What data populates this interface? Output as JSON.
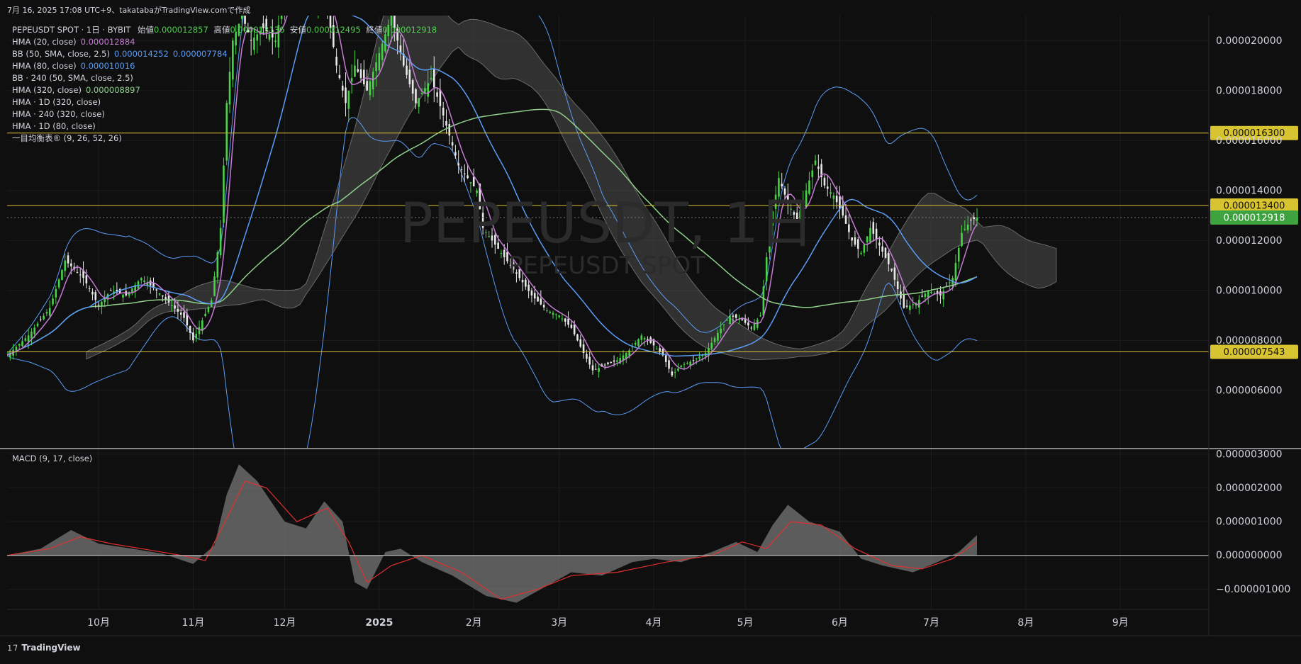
{
  "header": {
    "text": "7月 16, 2025 17:08 UTC+9、takatabaがTradingView.comで作成"
  },
  "legend": {
    "main_title": "PEPEUSDT SPOT · 1日 · BYBIT",
    "ohlc": [
      {
        "label": "始値",
        "value": "0.000012857"
      },
      {
        "label": "高値",
        "value": "0.000013136"
      },
      {
        "label": "安値",
        "value": "0.000012495"
      },
      {
        "label": "終値",
        "value": "0.000012918"
      }
    ],
    "indicators": [
      {
        "label": "HMA (20, close)",
        "values": [
          "0.000012884"
        ],
        "colors": [
          "#c77bd6"
        ]
      },
      {
        "label": "BB (50, SMA, close, 2.5)",
        "values": [
          "0.000014252",
          "0.000007784"
        ],
        "colors": [
          "#5b9cf6",
          "#5b9cf6"
        ]
      },
      {
        "label": "HMA (80, close)",
        "values": [
          "0.000010016"
        ],
        "colors": [
          "#5b9cf6"
        ]
      },
      {
        "label": "BB · 240 (50, SMA, close, 2.5)",
        "values": [],
        "colors": []
      },
      {
        "label": "HMA (320, close)",
        "values": [
          "0.000008897"
        ],
        "colors": [
          "#8fd18a"
        ]
      },
      {
        "label": "HMA · 1D (320, close)",
        "values": [],
        "colors": []
      },
      {
        "label": "HMA · 240 (320, close)",
        "values": [],
        "colors": []
      },
      {
        "label": "HMA · 1D (80, close)",
        "values": [],
        "colors": []
      },
      {
        "label": "一目均衡表® (9, 26, 52, 26)",
        "values": [],
        "colors": []
      }
    ]
  },
  "watermark": {
    "symbol": "PEPEUSDT, 1日",
    "sub": "PEPEUSDT SPOT"
  },
  "macd_label": "MACD (9, 17, close)",
  "footer": {
    "brand": "TradingView"
  },
  "colors": {
    "background": "#0f0f0f",
    "grid": "#1c1c1c",
    "up": "#4ad14a",
    "down": "#e8e8e8",
    "bb": "#5b9cf6",
    "hma20": "#c77bd6",
    "hma80": "#5b9cf6",
    "hma320": "#8fd18a",
    "hline": "#d8c330",
    "last_price": "#3ea33e",
    "cloud": "#5a5a5a",
    "macd_hist": "#777777",
    "macd_signal": "#e03030"
  },
  "chart_data": [
    {
      "type": "candlestick",
      "interval": "1日",
      "x_ticks": [
        "10月",
        "11月",
        "12月",
        "2025",
        "2月",
        "3月",
        "4月",
        "5月",
        "6月",
        "7月",
        "8月",
        "9月"
      ],
      "y_ticks": [
        "0.000020000",
        "0.000018000",
        "0.000016000",
        "0.000014000",
        "0.000012000",
        "0.000010000",
        "0.000008000",
        "0.000006000"
      ],
      "ylim": [
        3.7e-06,
        2.1e-05
      ],
      "horizontal_lines": [
        {
          "value": 1.63e-05,
          "label": "0.000016300"
        },
        {
          "value": 1.34e-05,
          "label": "0.000013400"
        },
        {
          "value": 7.543e-06,
          "label": "0.000007543"
        }
      ],
      "last_price": {
        "value": 1.2918e-05,
        "label": "0.000012918"
      },
      "close_path": [
        [
          "2024-09-01",
          7.4e-06
        ],
        [
          "2024-09-08",
          8.2e-06
        ],
        [
          "2024-09-15",
          9.3e-06
        ],
        [
          "2024-09-20",
          1.12e-05
        ],
        [
          "2024-09-26",
          1.05e-05
        ],
        [
          "2024-10-01",
          9.4e-06
        ],
        [
          "2024-10-05",
          1e-05
        ],
        [
          "2024-10-10",
          9.8e-06
        ],
        [
          "2024-10-15",
          1.05e-05
        ],
        [
          "2024-10-20",
          1e-05
        ],
        [
          "2024-10-25",
          9.4e-06
        ],
        [
          "2024-10-29",
          8.9e-06
        ],
        [
          "2024-11-01",
          8e-06
        ],
        [
          "2024-11-04",
          8.8e-06
        ],
        [
          "2024-11-07",
          9.6e-06
        ],
        [
          "2024-11-10",
          1.25e-05
        ],
        [
          "2024-11-12",
          1.75e-05
        ],
        [
          "2024-11-14",
          2e-05
        ],
        [
          "2024-11-17",
          2.1e-05
        ],
        [
          "2024-11-20",
          2e-05
        ],
        [
          "2024-11-24",
          2.05e-05
        ],
        [
          "2024-11-28",
          2e-05
        ],
        [
          "2024-12-02",
          2.25e-05
        ],
        [
          "2024-12-06",
          2.4e-05
        ],
        [
          "2024-12-10",
          2.15e-05
        ],
        [
          "2024-12-14",
          2.2e-05
        ],
        [
          "2024-12-18",
          1.9e-05
        ],
        [
          "2024-12-21",
          1.75e-05
        ],
        [
          "2024-12-24",
          1.9e-05
        ],
        [
          "2024-12-28",
          1.8e-05
        ],
        [
          "2025-01-01",
          1.95e-05
        ],
        [
          "2025-01-05",
          2.1e-05
        ],
        [
          "2025-01-09",
          1.9e-05
        ],
        [
          "2025-01-13",
          1.75e-05
        ],
        [
          "2025-01-18",
          1.85e-05
        ],
        [
          "2025-01-22",
          1.7e-05
        ],
        [
          "2025-01-27",
          1.5e-05
        ],
        [
          "2025-02-02",
          1.4e-05
        ],
        [
          "2025-02-04",
          1.25e-05
        ],
        [
          "2025-02-10",
          1.15e-05
        ],
        [
          "2025-02-16",
          1.05e-05
        ],
        [
          "2025-02-20",
          9.8e-06
        ],
        [
          "2025-02-25",
          9.2e-06
        ],
        [
          "2025-03-01",
          9e-06
        ],
        [
          "2025-03-05",
          8.5e-06
        ],
        [
          "2025-03-09",
          7.5e-06
        ],
        [
          "2025-03-12",
          6.8e-06
        ],
        [
          "2025-03-16",
          7e-06
        ],
        [
          "2025-03-20",
          7.2e-06
        ],
        [
          "2025-03-24",
          7.6e-06
        ],
        [
          "2025-03-28",
          8.2e-06
        ],
        [
          "2025-04-01",
          7.8e-06
        ],
        [
          "2025-04-04",
          7.4e-06
        ],
        [
          "2025-04-07",
          6.6e-06
        ],
        [
          "2025-04-10",
          7e-06
        ],
        [
          "2025-04-14",
          7.2e-06
        ],
        [
          "2025-04-18",
          7.5e-06
        ],
        [
          "2025-04-22",
          8.3e-06
        ],
        [
          "2025-04-26",
          9e-06
        ],
        [
          "2025-04-30",
          8.8e-06
        ],
        [
          "2025-05-03",
          8.5e-06
        ],
        [
          "2025-05-06",
          9e-06
        ],
        [
          "2025-05-09",
          1.25e-05
        ],
        [
          "2025-05-12",
          1.45e-05
        ],
        [
          "2025-05-15",
          1.35e-05
        ],
        [
          "2025-05-18",
          1.28e-05
        ],
        [
          "2025-05-21",
          1.4e-05
        ],
        [
          "2025-05-24",
          1.52e-05
        ],
        [
          "2025-05-27",
          1.42e-05
        ],
        [
          "2025-05-30",
          1.38e-05
        ],
        [
          "2025-06-02",
          1.3e-05
        ],
        [
          "2025-06-05",
          1.2e-05
        ],
        [
          "2025-06-08",
          1.15e-05
        ],
        [
          "2025-06-11",
          1.25e-05
        ],
        [
          "2025-06-14",
          1.18e-05
        ],
        [
          "2025-06-18",
          1.08e-05
        ],
        [
          "2025-06-22",
          9.3e-06
        ],
        [
          "2025-06-26",
          9.5e-06
        ],
        [
          "2025-06-30",
          1e-05
        ],
        [
          "2025-07-04",
          9.8e-06
        ],
        [
          "2025-07-08",
          1.05e-05
        ],
        [
          "2025-07-11",
          1.23e-05
        ],
        [
          "2025-07-14",
          1.28e-05
        ],
        [
          "2025-07-16",
          1.2918e-05
        ]
      ]
    },
    {
      "type": "area",
      "title": "MACD (9, 17, close)",
      "y_ticks": [
        "0.000003000",
        "0.000002000",
        "0.000001000",
        "0.000000000",
        "−0.000001000"
      ],
      "ylim": [
        -1.6e-06,
        3.1e-06
      ],
      "series": [
        {
          "name": "MACD",
          "values": [
            [
              "2024-09-01",
              0.0
            ],
            [
              "2024-09-12",
              2e-07
            ],
            [
              "2024-09-22",
              7.5e-07
            ],
            [
              "2024-10-01",
              3.5e-07
            ],
            [
              "2024-10-12",
              2e-07
            ],
            [
              "2024-10-22",
              5e-08
            ],
            [
              "2024-11-01",
              -2.5e-07
            ],
            [
              "2024-11-08",
              3e-07
            ],
            [
              "2024-11-12",
              1.8e-06
            ],
            [
              "2024-11-16",
              2.7e-06
            ],
            [
              "2024-11-22",
              2.2e-06
            ],
            [
              "2024-12-01",
              1e-06
            ],
            [
              "2024-12-08",
              8e-07
            ],
            [
              "2024-12-14",
              1.6e-06
            ],
            [
              "2024-12-20",
              1e-06
            ],
            [
              "2024-12-24",
              -8e-07
            ],
            [
              "2024-12-28",
              -1e-06
            ],
            [
              "2025-01-03",
              1e-07
            ],
            [
              "2025-01-08",
              2e-07
            ],
            [
              "2025-01-15",
              -2e-07
            ],
            [
              "2025-01-25",
              -6e-07
            ],
            [
              "2025-02-05",
              -1.2e-06
            ],
            [
              "2025-02-15",
              -1.4e-06
            ],
            [
              "2025-02-25",
              -9e-07
            ],
            [
              "2025-03-05",
              -5e-07
            ],
            [
              "2025-03-15",
              -6e-07
            ],
            [
              "2025-03-25",
              -2e-07
            ],
            [
              "2025-04-01",
              -1e-07
            ],
            [
              "2025-04-10",
              -2e-07
            ],
            [
              "2025-04-20",
              1e-07
            ],
            [
              "2025-04-28",
              4e-07
            ],
            [
              "2025-05-05",
              1e-07
            ],
            [
              "2025-05-10",
              9e-07
            ],
            [
              "2025-05-15",
              1.5e-06
            ],
            [
              "2025-05-22",
              1e-06
            ],
            [
              "2025-06-01",
              7e-07
            ],
            [
              "2025-06-08",
              -1e-07
            ],
            [
              "2025-06-15",
              -3e-07
            ],
            [
              "2025-06-25",
              -5e-07
            ],
            [
              "2025-07-03",
              -2e-07
            ],
            [
              "2025-07-10",
              1e-07
            ],
            [
              "2025-07-16",
              6e-07
            ]
          ]
        },
        {
          "name": "Signal",
          "values": [
            [
              "2024-09-01",
              0.0
            ],
            [
              "2024-09-15",
              2e-07
            ],
            [
              "2024-09-25",
              5.5e-07
            ],
            [
              "2024-10-05",
              3.5e-07
            ],
            [
              "2024-10-15",
              2e-07
            ],
            [
              "2024-10-28",
              0.0
            ],
            [
              "2024-11-05",
              -1.5e-07
            ],
            [
              "2024-11-12",
              1.1e-06
            ],
            [
              "2024-11-18",
              2.2e-06
            ],
            [
              "2024-11-25",
              2e-06
            ],
            [
              "2024-12-05",
              1e-06
            ],
            [
              "2024-12-15",
              1.4e-06
            ],
            [
              "2024-12-22",
              4e-07
            ],
            [
              "2024-12-28",
              -8e-07
            ],
            [
              "2025-01-05",
              -3e-07
            ],
            [
              "2025-01-15",
              0.0
            ],
            [
              "2025-01-28",
              -5e-07
            ],
            [
              "2025-02-10",
              -1.3e-06
            ],
            [
              "2025-02-22",
              -1e-06
            ],
            [
              "2025-03-05",
              -6e-07
            ],
            [
              "2025-03-20",
              -5e-07
            ],
            [
              "2025-04-05",
              -2e-07
            ],
            [
              "2025-04-20",
              0.0
            ],
            [
              "2025-04-30",
              4e-07
            ],
            [
              "2025-05-08",
              2e-07
            ],
            [
              "2025-05-16",
              1e-06
            ],
            [
              "2025-05-26",
              9e-07
            ],
            [
              "2025-06-06",
              2e-07
            ],
            [
              "2025-06-18",
              -3e-07
            ],
            [
              "2025-06-28",
              -4e-07
            ],
            [
              "2025-07-08",
              -1e-07
            ],
            [
              "2025-07-16",
              4e-07
            ]
          ]
        }
      ]
    }
  ]
}
